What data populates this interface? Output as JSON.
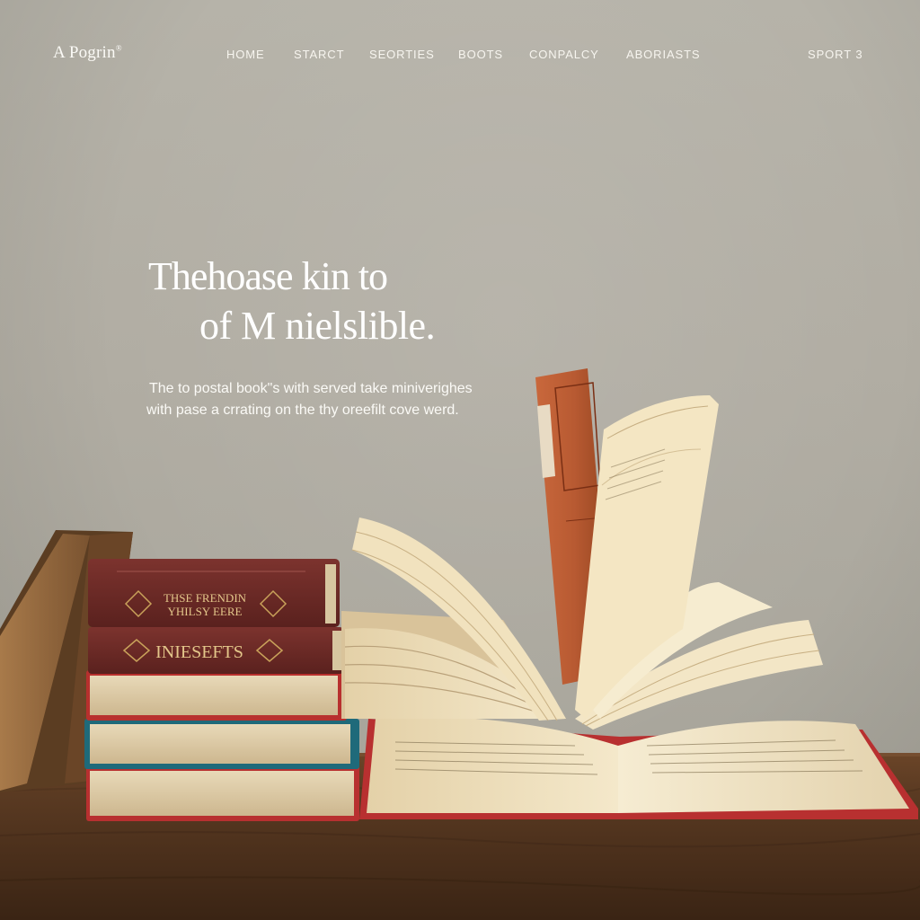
{
  "brand": {
    "name": "A Pogrin",
    "mark": "®"
  },
  "nav": {
    "items": [
      {
        "label": "HOME"
      },
      {
        "label": "STARCT"
      },
      {
        "label": "SEORTIES"
      },
      {
        "label": "BOOTS"
      },
      {
        "label": "CONPALCY"
      },
      {
        "label": "ABORIASTS"
      },
      {
        "label": "SPORT 3"
      }
    ]
  },
  "hero": {
    "title_line1": "Thehoase kin to",
    "title_line2": "of M nielslible.",
    "subtitle_line1": "The to postal book\"s with served take miniverighes",
    "subtitle_line2": "with pase a crrating on the thy oreefilt cove werd."
  },
  "books": {
    "spine_top_line1": "THSE FRENDIN",
    "spine_top_line2": "YHILSY EERE",
    "spine_second": "INIESEFTS"
  },
  "colors": {
    "background": "#b2afa5",
    "text": "#ffffff",
    "table": "#5a3a22",
    "book_maroon": "#6e2a26",
    "book_orange": "#b85a32"
  }
}
